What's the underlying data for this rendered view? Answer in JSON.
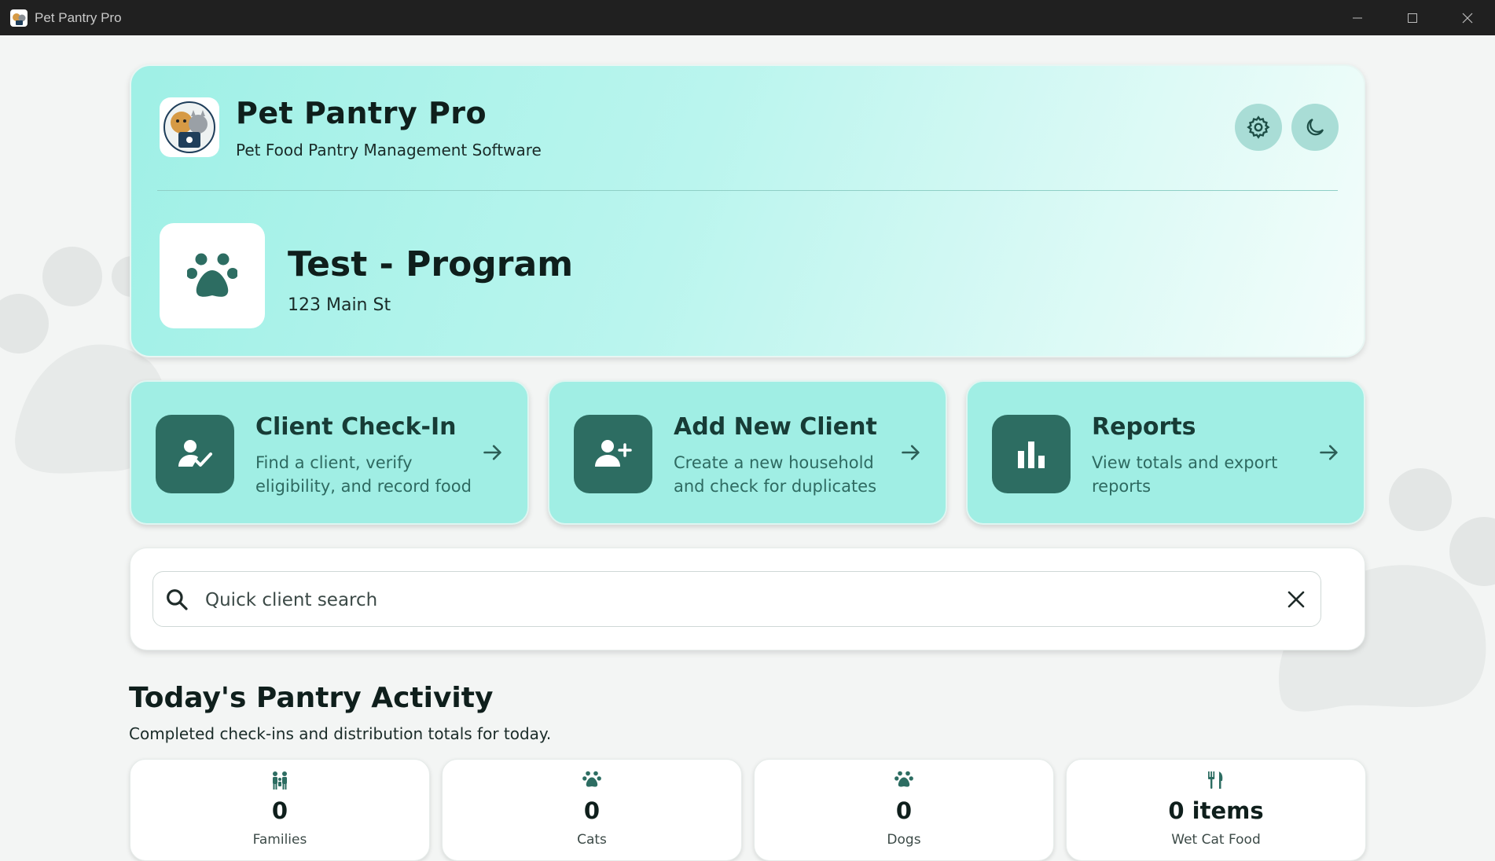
{
  "window": {
    "title": "Pet Pantry Pro"
  },
  "header": {
    "app_name": "Pet Pantry Pro",
    "app_subtitle": "Pet Food Pantry Management Software",
    "settings_icon": "gear-icon",
    "theme_icon": "moon-icon"
  },
  "program": {
    "name": "Test - Program",
    "address": "123 Main St",
    "logo_icon": "paw-icon"
  },
  "actions": [
    {
      "title": "Client Check-In",
      "description": "Find a client, verify eligibility, and record food",
      "icon": "user-check-icon"
    },
    {
      "title": "Add New Client",
      "description": "Create a new household and check for duplicates",
      "icon": "user-plus-icon"
    },
    {
      "title": "Reports",
      "description": "View totals and export reports",
      "icon": "bar-chart-icon"
    }
  ],
  "search": {
    "placeholder": "Quick client search",
    "value": ""
  },
  "activity": {
    "title": "Today's Pantry Activity",
    "subtitle": "Completed check-ins and distribution totals for today.",
    "stats": [
      {
        "value": "0",
        "label": "Families",
        "icon": "family-icon"
      },
      {
        "value": "0",
        "label": "Cats",
        "icon": "paw-icon"
      },
      {
        "value": "0",
        "label": "Dogs",
        "icon": "paw-icon"
      },
      {
        "value": "0 items",
        "label": "Wet Cat Food",
        "icon": "utensils-icon"
      }
    ]
  },
  "colors": {
    "accent_dark": "#2d6d62",
    "card_teal": "#a0eee4",
    "titlebar": "#202020"
  }
}
